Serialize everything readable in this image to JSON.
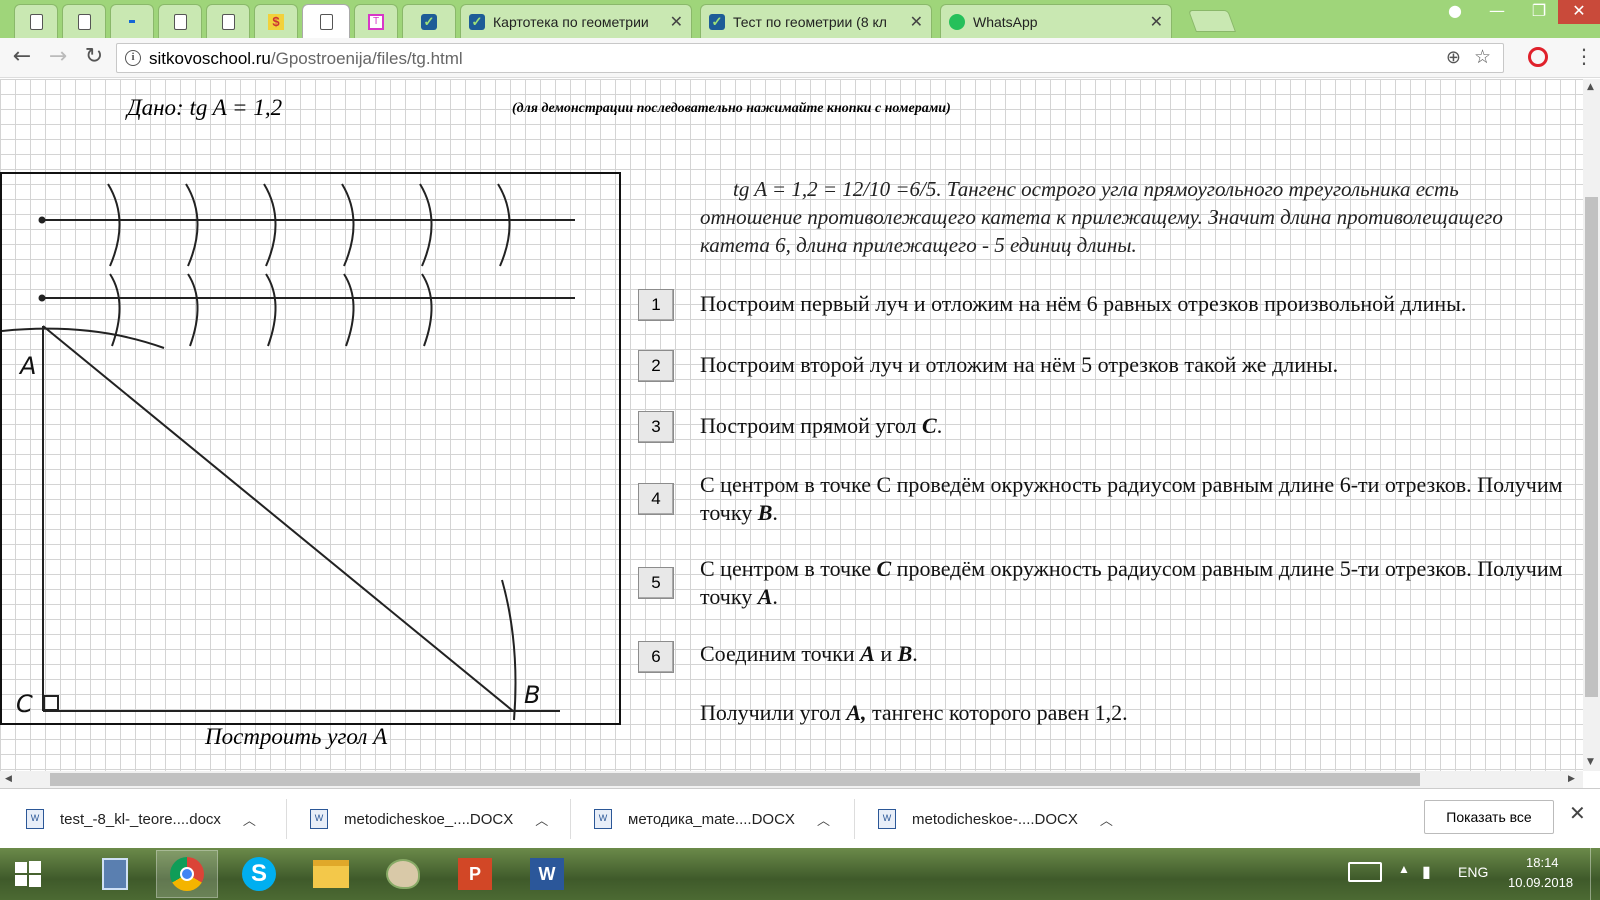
{
  "tabs": [
    {
      "title": "",
      "icon": "doc-icon"
    },
    {
      "title": "",
      "icon": "doc-icon"
    },
    {
      "title": "",
      "icon": "dot-icon"
    },
    {
      "title": "",
      "icon": "doc-icon"
    },
    {
      "title": "",
      "icon": "doc-icon"
    },
    {
      "title": "",
      "icon": "yandex-icon"
    },
    {
      "title": "",
      "icon": "doc-icon"
    },
    {
      "title": "",
      "icon": "pink-icon"
    },
    {
      "title": "",
      "icon": "check-icon"
    },
    {
      "title": "Картотека по геометрии",
      "icon": "check-icon"
    },
    {
      "title": "Тест по геометрии (8 кл",
      "icon": "check-icon"
    },
    {
      "title": "WhatsApp",
      "icon": "whatsapp-icon"
    }
  ],
  "address": {
    "domain": "sitkovoschool.ru",
    "path": "/Gpostroenija/files/tg.html"
  },
  "page": {
    "given": "Дано: tg A = 1,2",
    "hint": "(для демонстрации последовательно нажимайте кнопки с номерами)",
    "intro": "tg A = 1,2 = 12/10 =6/5. Тангенс острого угла прямоугольного треугольника есть отношение противолежащего катета к прилежащему. Значит длина противолещащего катета 6, длина прилежащего - 5 единиц длины.",
    "caption": "Построить угол А",
    "figure_labels": {
      "a": "A",
      "b": "B",
      "c": "C"
    },
    "steps": [
      {
        "num": "1",
        "text": "Построим первый луч и отложим на нём 6 равных отрезков произвольной длины."
      },
      {
        "num": "2",
        "text": "Построим второй луч и отложим на нём 5 отрезков такой же длины."
      },
      {
        "num": "3",
        "text": "Построим прямой угол <b>С</b>."
      },
      {
        "num": "4",
        "text": "С центром в точке С проведём окружность радиусом равным длине 6-ти отрезков. Получим точку <b>В</b>."
      },
      {
        "num": "5",
        "text": "С центром в точке <b>С</b> проведём окружность радиусом равным длине 5-ти отрезков. Получим точку <b>А</b>."
      },
      {
        "num": "6",
        "text": "Соединим точки <b>А</b> и <b>В</b>."
      }
    ],
    "result": "Получили угол <b>А,</b> тангенс которого равен 1,2."
  },
  "downloads": [
    {
      "name": "test_-8_kl-_teore....docx"
    },
    {
      "name": "metodicheskoe_....DOCX"
    },
    {
      "name": "методика_mate....DOCX"
    },
    {
      "name": "metodicheskoe-....DOCX"
    }
  ],
  "downloads_show_all": "Показать все",
  "tray": {
    "lang": "ENG",
    "time": "18:14",
    "date": "10.09.2018"
  }
}
